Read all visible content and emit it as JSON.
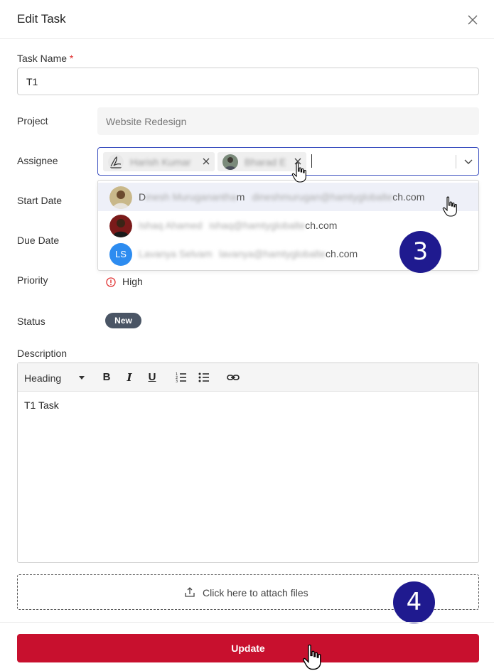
{
  "dialog": {
    "title": "Edit Task"
  },
  "form": {
    "task_name_label": "Task Name",
    "required_mark": "*",
    "task_name_value": "T1",
    "project_label": "Project",
    "project_value": "Website Redesign",
    "assignee_label": "Assignee",
    "assignee_tags": [
      {
        "name": "Harish Kumar"
      },
      {
        "name": "Bharad E"
      }
    ],
    "start_date_label": "Start Date",
    "due_date_label": "Due Date",
    "priority_label": "Priority",
    "priority_value": "High",
    "status_label": "Status",
    "status_value": "New",
    "description_label": "Description",
    "editor_heading": "Heading",
    "description_value": "T1 Task",
    "attach_label": "Click here to attach files",
    "update_label": "Update"
  },
  "dropdown": {
    "options": [
      {
        "name_start": "D",
        "name_blur": "inesh Muruganantha",
        "name_end": "m",
        "email_blur": "dineshmurugan@hamtyglobalte",
        "email_end": "ch.com"
      },
      {
        "name_start": "",
        "name_blur": "Ishaq Ahamed",
        "name_end": "",
        "email_blur": "ishaq@hamtyglobalte",
        "email_end": "ch.com"
      },
      {
        "name_start": "",
        "name_blur": "Lavanya Selvam",
        "name_end": "",
        "email_blur": "lavanya@hamtyglobalte",
        "email_end": "ch.com",
        "initials": "LS"
      }
    ]
  },
  "annotations": {
    "step3": "3",
    "step4": "4"
  },
  "colors": {
    "accent": "#3b4fbf",
    "primary_button": "#c8102e",
    "status_pill": "#4a5565",
    "step_badge": "#1f1a8f",
    "priority_icon": "#e03131"
  }
}
